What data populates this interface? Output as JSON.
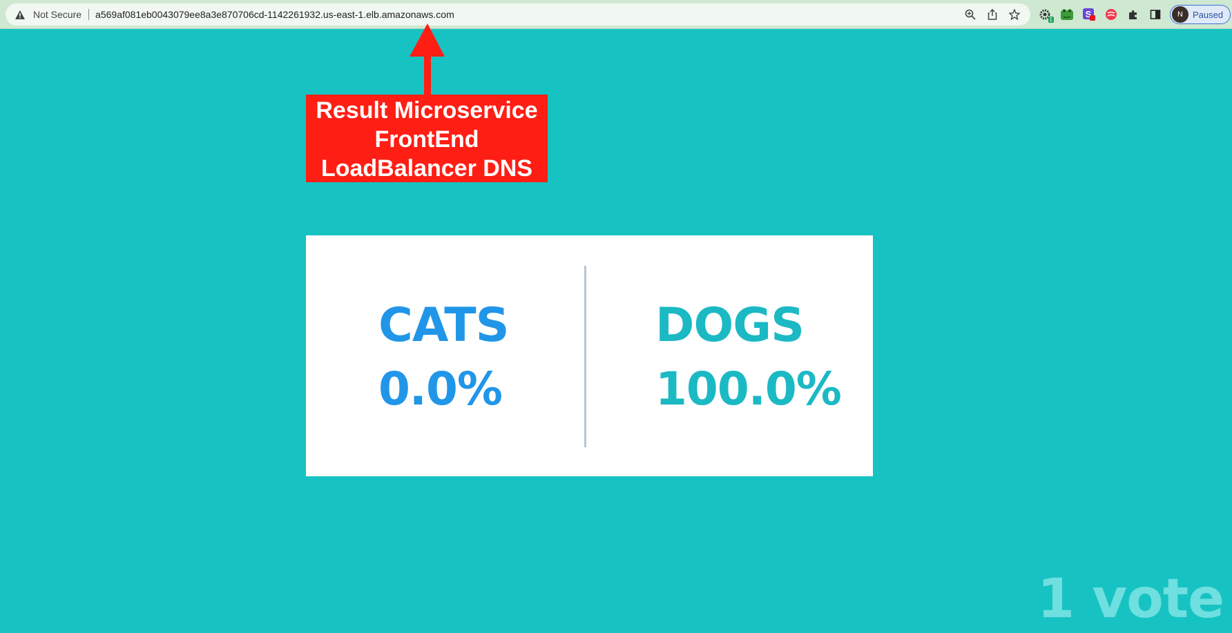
{
  "browser": {
    "security_label": "Not Secure",
    "url": "a569af081eb0043079ee8a3e870706cd-1142261932.us-east-1.elb.amazonaws.com",
    "profile_label": "Paused",
    "profile_initial": "N",
    "extension_badge": "1",
    "icons": [
      "warning-icon",
      "zoom-icon",
      "share-icon",
      "bookmark-star-icon",
      "gear-extension-icon",
      "frog-extension-icon",
      "s-extension-icon",
      "red-extension-icon",
      "puzzle-extensions-icon",
      "side-panel-icon"
    ]
  },
  "annotation": {
    "lines": [
      "Result Microservice",
      "FrontEnd",
      "LoadBalancer DNS"
    ],
    "color": "#ff1e14"
  },
  "results": {
    "option_a": {
      "label": "CATS",
      "percent": "0.0%",
      "color": "#2196e8"
    },
    "option_b": {
      "label": "DOGS",
      "percent": "100.0%",
      "color": "#1bb9c4"
    }
  },
  "vote_count": "1 vote",
  "colors": {
    "background": "#17c3c2",
    "card": "#ffffff"
  }
}
